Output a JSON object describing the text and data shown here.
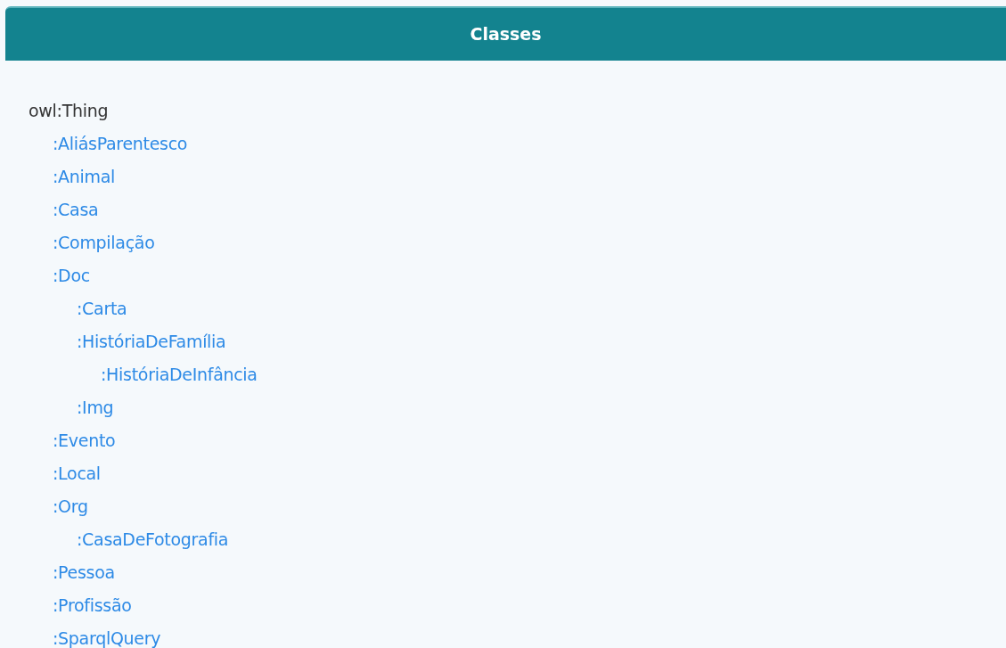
{
  "panel": {
    "title": "Classes"
  },
  "tree": [
    {
      "label": "owl:Thing",
      "kind": "root",
      "children": [
        {
          "label": ":AliásParentesco",
          "kind": "class"
        },
        {
          "label": ":Animal",
          "kind": "class"
        },
        {
          "label": ":Casa",
          "kind": "class"
        },
        {
          "label": ":Compilação",
          "kind": "class"
        },
        {
          "label": ":Doc",
          "kind": "class",
          "children": [
            {
              "label": ":Carta",
              "kind": "class"
            },
            {
              "label": ":HistóriaDeFamília",
              "kind": "class",
              "children": [
                {
                  "label": ":HistóriaDeInfância",
                  "kind": "class"
                }
              ]
            },
            {
              "label": ":Img",
              "kind": "class"
            }
          ]
        },
        {
          "label": ":Evento",
          "kind": "class"
        },
        {
          "label": ":Local",
          "kind": "class"
        },
        {
          "label": ":Org",
          "kind": "class",
          "children": [
            {
              "label": ":CasaDeFotografia",
              "kind": "class"
            }
          ]
        },
        {
          "label": ":Pessoa",
          "kind": "class"
        },
        {
          "label": ":Profissão",
          "kind": "class"
        },
        {
          "label": ":SparqlQuery",
          "kind": "class"
        }
      ]
    }
  ]
}
